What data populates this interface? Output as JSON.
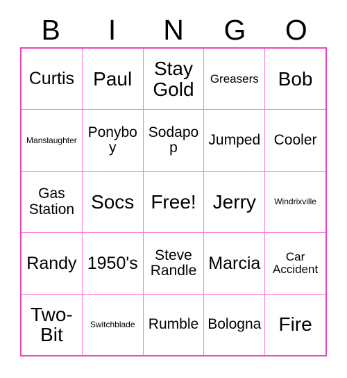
{
  "card": {
    "title": "BINGO",
    "border_color": "#ee44bb",
    "grid_line_color": "#ff77dd",
    "text_color": "#000000",
    "background_color": "#ffffff"
  },
  "header": {
    "letters": [
      "B",
      "I",
      "N",
      "G",
      "O"
    ]
  },
  "grid": {
    "rows": [
      [
        {
          "text": "Curtis",
          "size": "lg"
        },
        {
          "text": "Paul",
          "size": "xl"
        },
        {
          "text": "Stay Gold",
          "size": "xl"
        },
        {
          "text": "Greasers",
          "size": "sm"
        },
        {
          "text": "Bob",
          "size": "xl"
        }
      ],
      [
        {
          "text": "Manslaughter",
          "size": "xs"
        },
        {
          "text": "Ponyboy",
          "size": "md"
        },
        {
          "text": "Sodapop",
          "size": "md"
        },
        {
          "text": "Jumped",
          "size": "md"
        },
        {
          "text": "Cooler",
          "size": "md"
        }
      ],
      [
        {
          "text": "Gas Station",
          "size": "md"
        },
        {
          "text": "Socs",
          "size": "xl"
        },
        {
          "text": "Free!",
          "size": "xl"
        },
        {
          "text": "Jerry",
          "size": "xl"
        },
        {
          "text": "Windrixville",
          "size": "xs"
        }
      ],
      [
        {
          "text": "Randy",
          "size": "lg"
        },
        {
          "text": "1950's",
          "size": "lg"
        },
        {
          "text": "Steve Randle",
          "size": "md"
        },
        {
          "text": "Marcia",
          "size": "lg"
        },
        {
          "text": "Car Accident",
          "size": "sm"
        }
      ],
      [
        {
          "text": "Two-Bit",
          "size": "xl"
        },
        {
          "text": "Switchblade",
          "size": "xs"
        },
        {
          "text": "Rumble",
          "size": "md"
        },
        {
          "text": "Bologna",
          "size": "md"
        },
        {
          "text": "Fire",
          "size": "xl"
        }
      ]
    ]
  }
}
